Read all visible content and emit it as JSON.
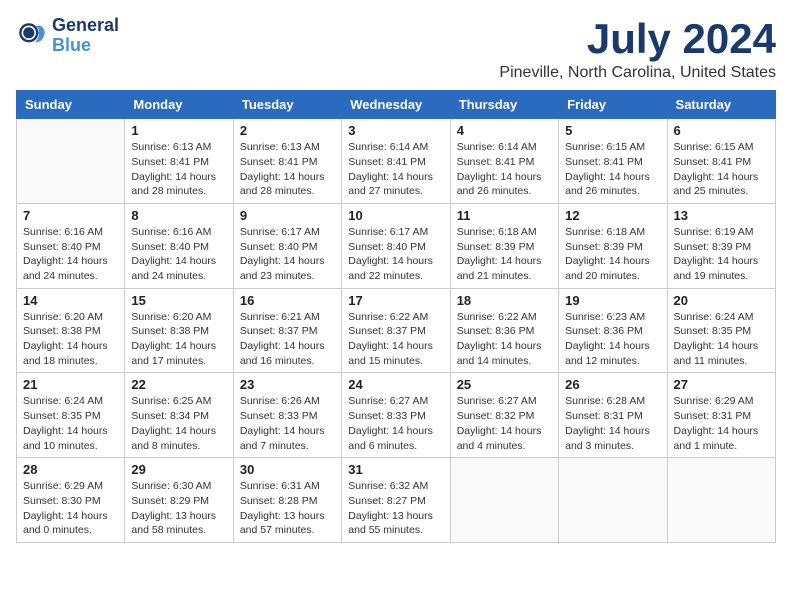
{
  "logo": {
    "text_general": "General",
    "text_blue": "Blue"
  },
  "title": "July 2024",
  "location": "Pineville, North Carolina, United States",
  "days_of_week": [
    "Sunday",
    "Monday",
    "Tuesday",
    "Wednesday",
    "Thursday",
    "Friday",
    "Saturday"
  ],
  "weeks": [
    [
      {
        "day": "",
        "info": ""
      },
      {
        "day": "1",
        "info": "Sunrise: 6:13 AM\nSunset: 8:41 PM\nDaylight: 14 hours and 28 minutes."
      },
      {
        "day": "2",
        "info": "Sunrise: 6:13 AM\nSunset: 8:41 PM\nDaylight: 14 hours and 28 minutes."
      },
      {
        "day": "3",
        "info": "Sunrise: 6:14 AM\nSunset: 8:41 PM\nDaylight: 14 hours and 27 minutes."
      },
      {
        "day": "4",
        "info": "Sunrise: 6:14 AM\nSunset: 8:41 PM\nDaylight: 14 hours and 26 minutes."
      },
      {
        "day": "5",
        "info": "Sunrise: 6:15 AM\nSunset: 8:41 PM\nDaylight: 14 hours and 26 minutes."
      },
      {
        "day": "6",
        "info": "Sunrise: 6:15 AM\nSunset: 8:41 PM\nDaylight: 14 hours and 25 minutes."
      }
    ],
    [
      {
        "day": "7",
        "info": "Sunrise: 6:16 AM\nSunset: 8:40 PM\nDaylight: 14 hours and 24 minutes."
      },
      {
        "day": "8",
        "info": "Sunrise: 6:16 AM\nSunset: 8:40 PM\nDaylight: 14 hours and 24 minutes."
      },
      {
        "day": "9",
        "info": "Sunrise: 6:17 AM\nSunset: 8:40 PM\nDaylight: 14 hours and 23 minutes."
      },
      {
        "day": "10",
        "info": "Sunrise: 6:17 AM\nSunset: 8:40 PM\nDaylight: 14 hours and 22 minutes."
      },
      {
        "day": "11",
        "info": "Sunrise: 6:18 AM\nSunset: 8:39 PM\nDaylight: 14 hours and 21 minutes."
      },
      {
        "day": "12",
        "info": "Sunrise: 6:18 AM\nSunset: 8:39 PM\nDaylight: 14 hours and 20 minutes."
      },
      {
        "day": "13",
        "info": "Sunrise: 6:19 AM\nSunset: 8:39 PM\nDaylight: 14 hours and 19 minutes."
      }
    ],
    [
      {
        "day": "14",
        "info": "Sunrise: 6:20 AM\nSunset: 8:38 PM\nDaylight: 14 hours and 18 minutes."
      },
      {
        "day": "15",
        "info": "Sunrise: 6:20 AM\nSunset: 8:38 PM\nDaylight: 14 hours and 17 minutes."
      },
      {
        "day": "16",
        "info": "Sunrise: 6:21 AM\nSunset: 8:37 PM\nDaylight: 14 hours and 16 minutes."
      },
      {
        "day": "17",
        "info": "Sunrise: 6:22 AM\nSunset: 8:37 PM\nDaylight: 14 hours and 15 minutes."
      },
      {
        "day": "18",
        "info": "Sunrise: 6:22 AM\nSunset: 8:36 PM\nDaylight: 14 hours and 14 minutes."
      },
      {
        "day": "19",
        "info": "Sunrise: 6:23 AM\nSunset: 8:36 PM\nDaylight: 14 hours and 12 minutes."
      },
      {
        "day": "20",
        "info": "Sunrise: 6:24 AM\nSunset: 8:35 PM\nDaylight: 14 hours and 11 minutes."
      }
    ],
    [
      {
        "day": "21",
        "info": "Sunrise: 6:24 AM\nSunset: 8:35 PM\nDaylight: 14 hours and 10 minutes."
      },
      {
        "day": "22",
        "info": "Sunrise: 6:25 AM\nSunset: 8:34 PM\nDaylight: 14 hours and 8 minutes."
      },
      {
        "day": "23",
        "info": "Sunrise: 6:26 AM\nSunset: 8:33 PM\nDaylight: 14 hours and 7 minutes."
      },
      {
        "day": "24",
        "info": "Sunrise: 6:27 AM\nSunset: 8:33 PM\nDaylight: 14 hours and 6 minutes."
      },
      {
        "day": "25",
        "info": "Sunrise: 6:27 AM\nSunset: 8:32 PM\nDaylight: 14 hours and 4 minutes."
      },
      {
        "day": "26",
        "info": "Sunrise: 6:28 AM\nSunset: 8:31 PM\nDaylight: 14 hours and 3 minutes."
      },
      {
        "day": "27",
        "info": "Sunrise: 6:29 AM\nSunset: 8:31 PM\nDaylight: 14 hours and 1 minute."
      }
    ],
    [
      {
        "day": "28",
        "info": "Sunrise: 6:29 AM\nSunset: 8:30 PM\nDaylight: 14 hours and 0 minutes."
      },
      {
        "day": "29",
        "info": "Sunrise: 6:30 AM\nSunset: 8:29 PM\nDaylight: 13 hours and 58 minutes."
      },
      {
        "day": "30",
        "info": "Sunrise: 6:31 AM\nSunset: 8:28 PM\nDaylight: 13 hours and 57 minutes."
      },
      {
        "day": "31",
        "info": "Sunrise: 6:32 AM\nSunset: 8:27 PM\nDaylight: 13 hours and 55 minutes."
      },
      {
        "day": "",
        "info": ""
      },
      {
        "day": "",
        "info": ""
      },
      {
        "day": "",
        "info": ""
      }
    ]
  ]
}
